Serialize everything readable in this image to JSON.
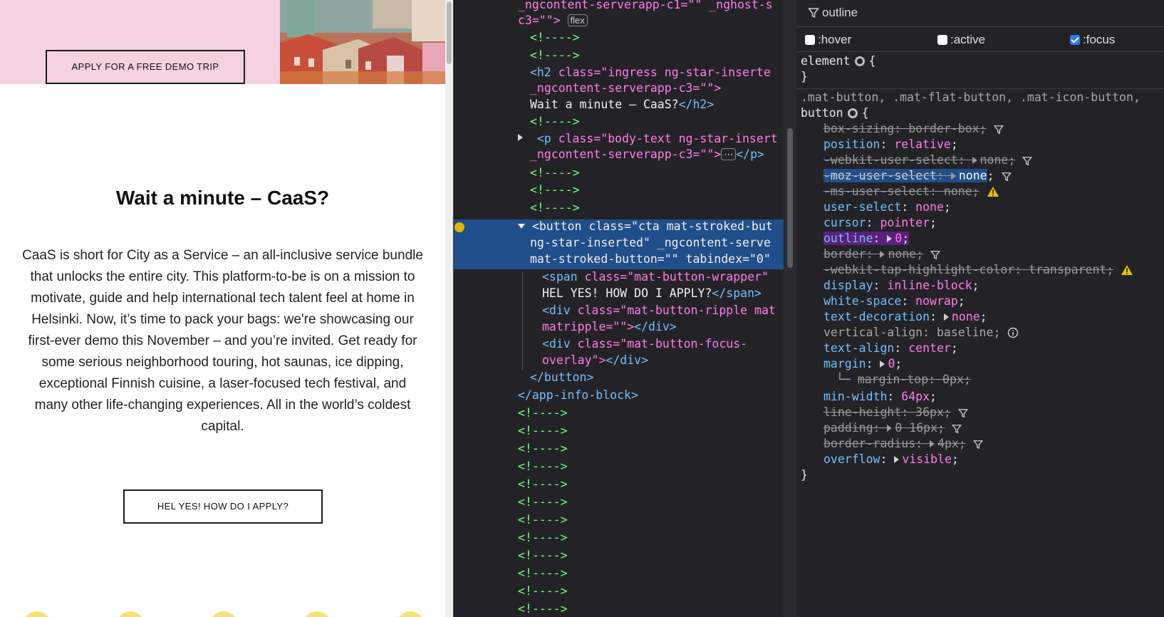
{
  "page": {
    "demo_button": "APPLY FOR A FREE DEMO TRIP",
    "heading": "Wait a minute – CaaS?",
    "body": "CaaS is short for City as a Service – an all-inclusive service bundle that unlocks the entire city. This platform-to-be is on a mission to motivate, guide and help international tech talent feel at home in Helsinki. Now, it’s time to pack your bags: we're showcasing our first-ever demo this November – and you’re invited. Get ready for some serious neighborhood touring, hot saunas, ice dipping, exceptional Finnish cuisine, a laser-focused tech festival, and many other life-changing experiences. All in the world’s coldest capital.",
    "apply_button": "HEL YES! HOW DO I APPLY?"
  },
  "markup": {
    "comment": "<!---->",
    "line_host_a": "_ngcontent-serverapp-c1=\"\" _nghost-s",
    "line_host_b_attr": "c3=\"\">",
    "flex_badge": "flex",
    "h2_open": "<h2 ",
    "h2_class_attr": "class=",
    "h2_class_val": "\"ingress ng-star-inserte",
    "h2_ng": "_ngcontent-serverapp-c3=\"\">",
    "h2_text": "Wait a minute – CaaS?",
    "h2_close": "</h2>",
    "p_open": "<p ",
    "p_class_attr": "class=",
    "p_class_val": "\"body-text ng-star-insert",
    "p_ng": "_ngcontent-serverapp-c3=\"\">",
    "ellipsis_badge": "⋯",
    "p_close": "</p>",
    "btn_open": "<button ",
    "btn_class_attr": "class=",
    "btn_class_val": "\"cta mat-stroked-but",
    "btn_line2": "ng-star-inserted\" _ngcontent-serve",
    "btn_line3": "mat-stroked-button=\"\" tabindex=\"0\"",
    "span_open": "<span ",
    "span_class_attr": "class=",
    "span_class_val": "\"mat-button-wrapper\"",
    "span_text": "HEL YES! HOW DO I APPLY?",
    "span_close": "</span>",
    "div1_open": "<div ",
    "div1_class_attr": "class=",
    "div1_class_val": "\"mat-button-ripple mat",
    "div1_line2": "matripple=\"\">",
    "div_close": "</div>",
    "div2_open": "<div ",
    "div2_class_attr": "class=",
    "div2_class_val": "\"mat-button-focus-",
    "div2_line2": "overlay\">",
    "button_close": "</button>",
    "app_close": "</app-info-block>"
  },
  "rules": {
    "filter_text": "outline",
    "pseudo": [
      {
        "label": ":hover",
        "checked": false
      },
      {
        "label": ":active",
        "checked": false
      },
      {
        "label": ":focus",
        "checked": true
      }
    ],
    "element_selector": "element",
    "open_brace": "{",
    "close_brace": "}",
    "button_selector_line": ".mat-button, .mat-flat-button, .mat-icon-button,",
    "button_selector": "button",
    "decls": {
      "box_sizing": {
        "prop": "box-sizing",
        "value": "border-box"
      },
      "position": {
        "prop": "position",
        "value": "relative"
      },
      "webkit_user_select": {
        "prop": "-webkit-user-select",
        "value": "none"
      },
      "moz_user_select": {
        "prop": "-moz-user-select",
        "value": "none"
      },
      "ms_user_select": {
        "prop": "-ms-user-select",
        "value": "none"
      },
      "user_select": {
        "prop": "user-select",
        "value": "none"
      },
      "cursor": {
        "prop": "cursor",
        "value": "pointer"
      },
      "outline": {
        "prop": "outline",
        "value": "0"
      },
      "border": {
        "prop": "border",
        "value": "none"
      },
      "tap_highlight": {
        "prop": "-webkit-tap-highlight-color",
        "value": "transparent"
      },
      "display": {
        "prop": "display",
        "value": "inline-block"
      },
      "white_space": {
        "prop": "white-space",
        "value": "nowrap"
      },
      "text_decoration": {
        "prop": "text-decoration",
        "value": "none"
      },
      "vertical_align": {
        "prop": "vertical-align",
        "value": "baseline"
      },
      "text_align": {
        "prop": "text-align",
        "value": "center"
      },
      "margin": {
        "prop": "margin",
        "value": "0"
      },
      "margin_top": {
        "prop": "margin-top",
        "value": "0px"
      },
      "min_width": {
        "prop": "min-width",
        "value": "64px"
      },
      "line_height": {
        "prop": "line-height",
        "value": "36px"
      },
      "padding": {
        "prop": "padding",
        "value": "0 16px"
      },
      "border_radius": {
        "prop": "border-radius",
        "value": "4px"
      },
      "overflow": {
        "prop": "overflow",
        "value": "visible"
      }
    }
  },
  "colors": {
    "hero_pink": "#f4d2df",
    "devtools_bg": "#232327",
    "selected_row": "#204e8a",
    "highlight_purple": "#5a1f7a",
    "accent_yellow": "#f7e27a"
  }
}
